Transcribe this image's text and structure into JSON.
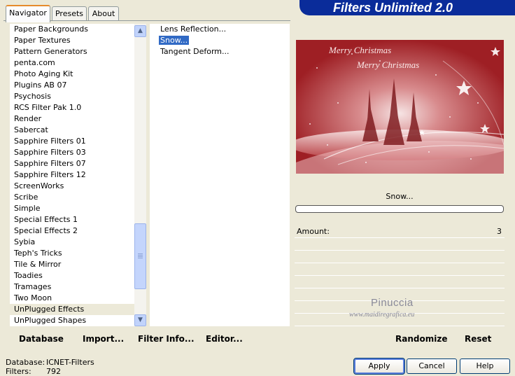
{
  "tabs": [
    "Navigator",
    "Presets",
    "About"
  ],
  "banner_title": "Filters Unlimited 2.0",
  "categories": [
    "Paper Backgrounds",
    "Paper Textures",
    "Pattern Generators",
    "penta.com",
    "Photo Aging Kit",
    "Plugins AB 07",
    "Psychosis",
    "RCS Filter Pak 1.0",
    "Render",
    "Sabercat",
    "Sapphire Filters 01",
    "Sapphire Filters 03",
    "Sapphire Filters 07",
    "Sapphire Filters 12",
    "ScreenWorks",
    "Scribe",
    "Simple",
    "Special Effects 1",
    "Special Effects 2",
    "Sybia",
    "Teph's Tricks",
    "Tile & Mirror",
    "Toadies",
    "Tramages",
    "Two Moon",
    "UnPlugged Effects",
    "UnPlugged Shapes"
  ],
  "selected_category": "UnPlugged Effects",
  "filters": [
    "Lens Reflection...",
    "Snow...",
    "Tangent Deform..."
  ],
  "selected_filter": "Snow...",
  "preview_texts": [
    "Merry Christmas",
    "Merry Christmas"
  ],
  "filter_title": "Snow...",
  "parameters": [
    {
      "label": "Amount:",
      "value": "3"
    }
  ],
  "watermark": {
    "name": "Pinuccia",
    "url": "www.maidiregrafica.eu"
  },
  "toolbar": {
    "database": "Database",
    "import": "Import...",
    "filter_info": "Filter Info...",
    "editor": "Editor...",
    "randomize": "Randomize",
    "reset": "Reset"
  },
  "status": {
    "database_label": "Database:",
    "database_value": "ICNET-Filters",
    "filters_label": "Filters:",
    "filters_value": "792"
  },
  "buttons": {
    "apply": "Apply",
    "cancel": "Cancel",
    "help": "Help"
  },
  "colors": {
    "banner": "#0a2c9a",
    "selection": "#316ac5",
    "preview_red": "#b52a2e"
  }
}
